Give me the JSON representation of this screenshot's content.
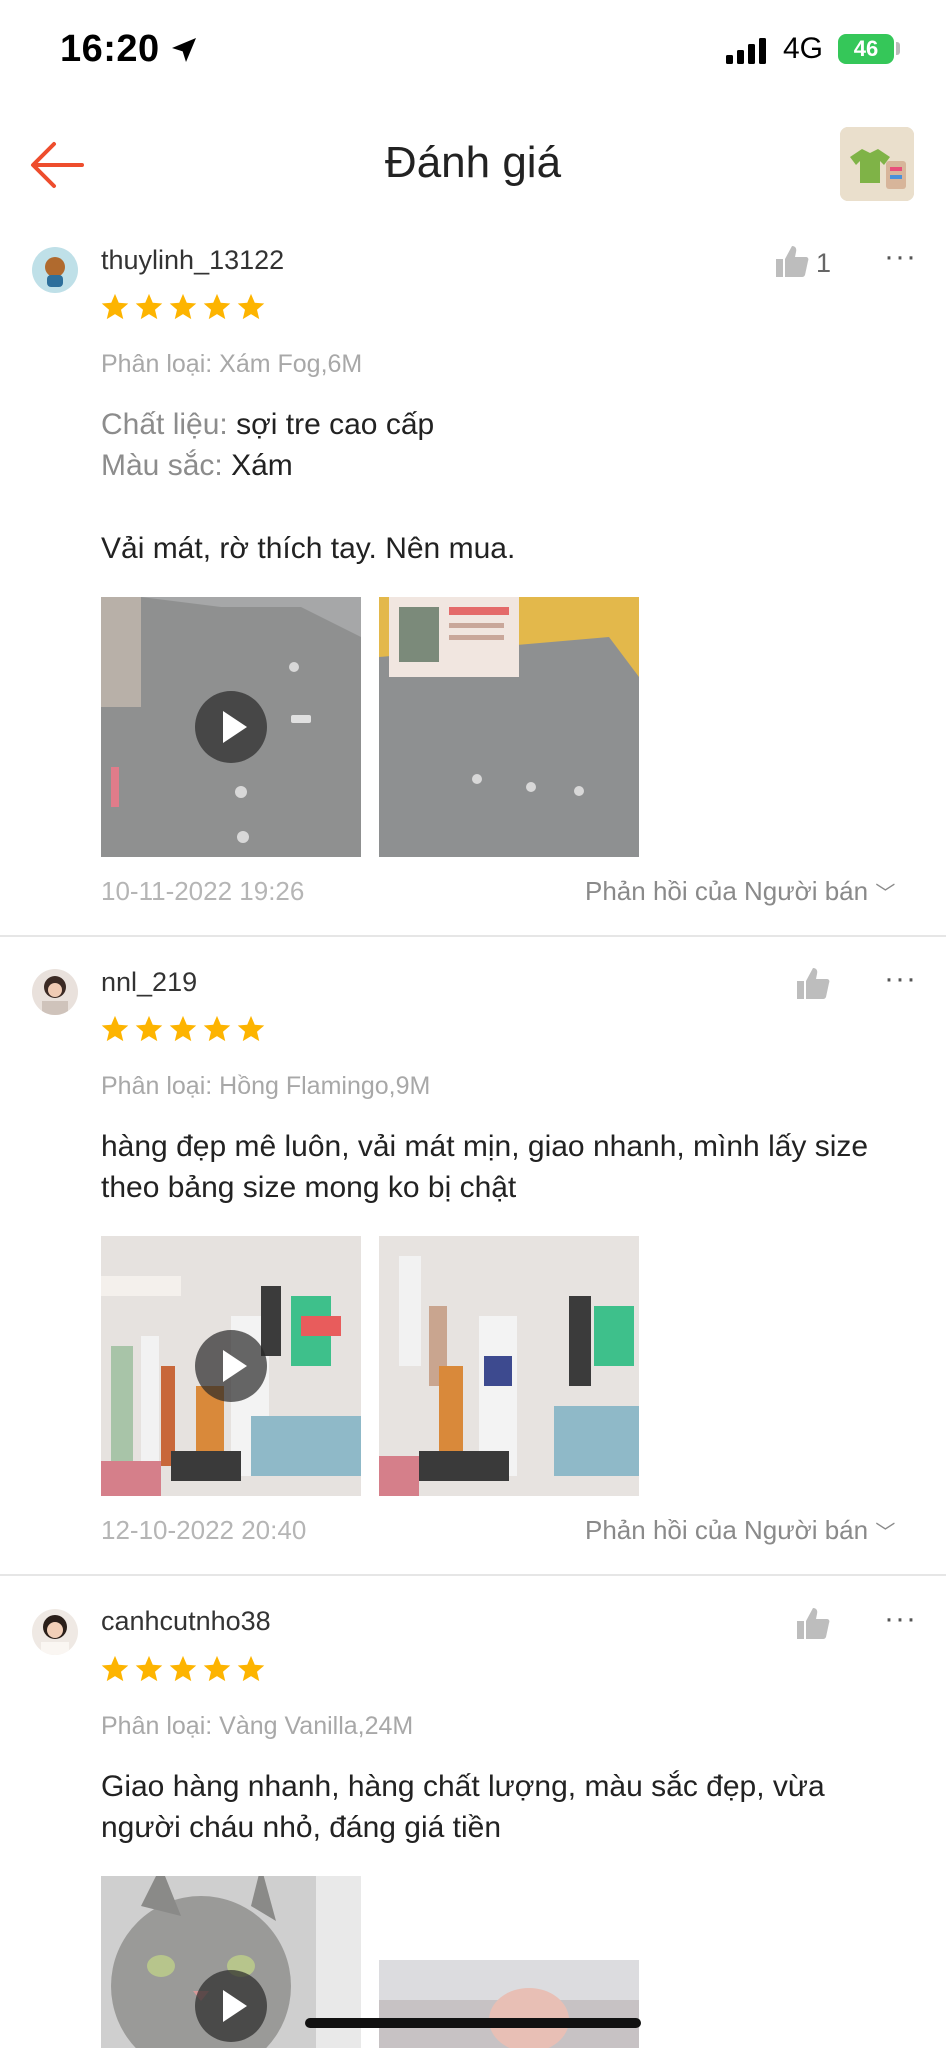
{
  "status_bar": {
    "time": "16:20",
    "network": "4G",
    "battery": "46"
  },
  "header": {
    "title": "Đánh giá",
    "back_icon": "arrow-left-icon",
    "accent": "#ee4d2d"
  },
  "reviews": [
    {
      "username": "thuylinh_13122",
      "rating": 5,
      "likes": "1",
      "variant": "Phân loại: Xám Fog,6M",
      "details": [
        {
          "label": "Chất liệu:",
          "value": "sợi tre cao cấp"
        },
        {
          "label": "Màu sắc:",
          "value": "Xám"
        }
      ],
      "text": "Vải mát, rờ thích tay. Nên mua.",
      "date": "10-11-2022 19:26",
      "reply": "Phản hồi của Người bán"
    },
    {
      "username": "nnl_219",
      "rating": 5,
      "likes": "",
      "variant": "Phân loại: Hồng Flamingo,9M",
      "details": [],
      "text": "hàng đẹp mê luôn, vải mát mịn, giao nhanh, mình lấy size theo bảng size mong ko bị chật",
      "date": "12-10-2022 20:40",
      "reply": "Phản hồi của Người bán"
    },
    {
      "username": "canhcutnho38",
      "rating": 5,
      "likes": "",
      "variant": "Phân loại: Vàng Vanilla,24M",
      "details": [],
      "text": "Giao hàng nhanh, hàng chất lượng, màu sắc đẹp, vừa người cháu nhỏ, đáng giá tiền",
      "date": "",
      "reply": ""
    }
  ],
  "colors": {
    "star": "#fdb400",
    "text": "#222222",
    "muted": "#a8a8a8",
    "battery": "#35c759"
  }
}
